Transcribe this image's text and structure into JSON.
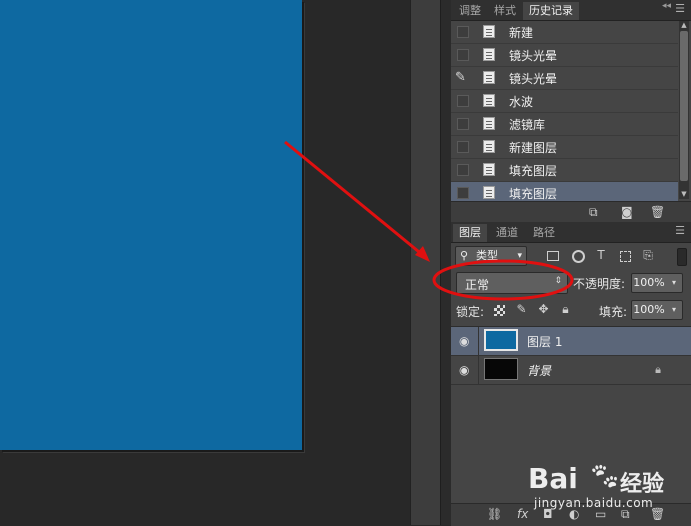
{
  "history_panel": {
    "tabs": [
      {
        "label": "调整"
      },
      {
        "label": "样式"
      },
      {
        "label": "历史记录"
      }
    ],
    "items": [
      {
        "label": "新建",
        "brush": false,
        "selected": false
      },
      {
        "label": "镜头光晕",
        "brush": false,
        "selected": false
      },
      {
        "label": "镜头光晕",
        "brush": true,
        "selected": false
      },
      {
        "label": "水波",
        "brush": false,
        "selected": false
      },
      {
        "label": "滤镜库",
        "brush": false,
        "selected": false
      },
      {
        "label": "新建图层",
        "brush": false,
        "selected": false
      },
      {
        "label": "填充图层",
        "brush": false,
        "selected": false
      },
      {
        "label": "填充图层",
        "brush": false,
        "selected": true
      }
    ]
  },
  "layers_panel": {
    "tabs": [
      {
        "label": "图层"
      },
      {
        "label": "通道"
      },
      {
        "label": "路径"
      }
    ],
    "filter_label": "类型",
    "blend_mode": "正常",
    "opacity_label": "不透明度:",
    "opacity_value": "100%",
    "lock_label": "锁定:",
    "fill_label": "填充:",
    "fill_value": "100%",
    "layers": [
      {
        "name": "图层 1",
        "selected": true,
        "thumb": "blue",
        "italic": false,
        "locked": false
      },
      {
        "name": "背景",
        "selected": false,
        "thumb": "black",
        "italic": true,
        "locked": true
      }
    ]
  },
  "colors": {
    "canvas_fill": "#0e69a1",
    "selection": "#5b6679",
    "annotation": "#e01010"
  },
  "watermark": {
    "logo": "Bai",
    "logo_cn": "经验",
    "url": "jingyan.baidu.com"
  }
}
